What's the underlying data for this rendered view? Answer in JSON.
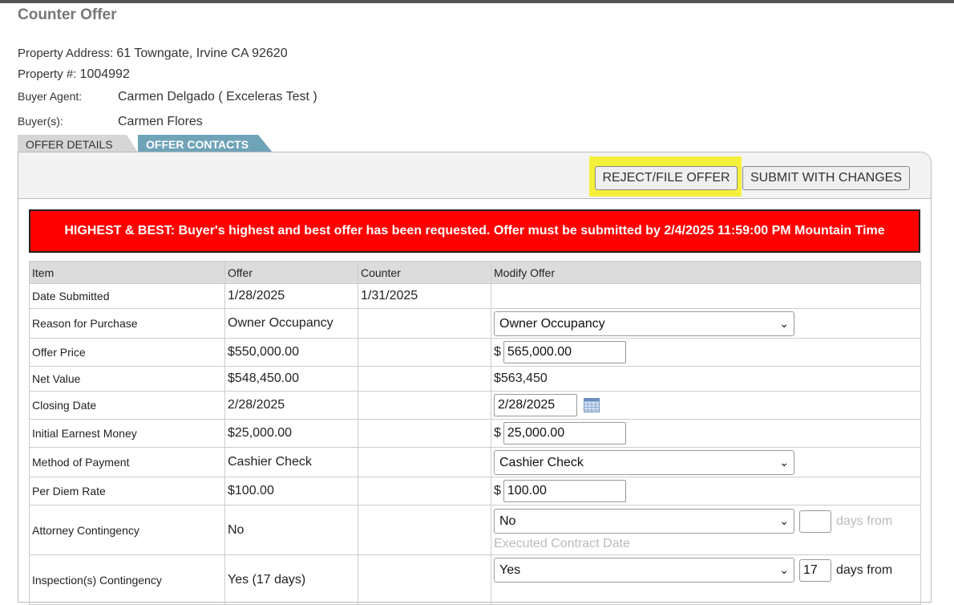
{
  "page": {
    "title": "Counter Offer"
  },
  "info": {
    "address_label": "Property Address:",
    "address_value": "61 Towngate, Irvine CA 92620",
    "property_label": "Property #:",
    "property_value": "1004992",
    "agent_label": "Buyer Agent:",
    "agent_value": "Carmen Delgado ( Exceleras Test )",
    "buyer_label": "Buyer(s):",
    "buyer_value": "Carmen Flores"
  },
  "tabs": {
    "details": "OFFER DETAILS",
    "contacts": "OFFER CONTACTS"
  },
  "toolbar": {
    "reject_label": "REJECT/FILE OFFER",
    "submit_label": "SUBMIT WITH CHANGES"
  },
  "banner": {
    "text": "HIGHEST & BEST: Buyer's highest and best offer has been requested. Offer must be submitted by 2/4/2025 11:59:00 PM Mountain Time"
  },
  "table": {
    "headers": {
      "item": "Item",
      "offer": "Offer",
      "counter": "Counter",
      "modify": "Modify Offer"
    },
    "rows": {
      "date_submitted": {
        "item": "Date Submitted",
        "offer": "1/28/2025",
        "counter": "1/31/2025"
      },
      "reason": {
        "item": "Reason for Purchase",
        "offer": "Owner Occupancy",
        "modify": "Owner Occupancy"
      },
      "price": {
        "item": "Offer Price",
        "offer": "$550,000.00",
        "currency": "$",
        "modify": "565,000.00"
      },
      "net": {
        "item": "Net Value",
        "offer": "$548,450.00",
        "modify": "$563,450"
      },
      "closing": {
        "item": "Closing Date",
        "offer": "2/28/2025",
        "modify": "2/28/2025"
      },
      "earnest": {
        "item": "Initial Earnest Money",
        "offer": "$25,000.00",
        "currency": "$",
        "modify": "25,000.00"
      },
      "payment": {
        "item": "Method of Payment",
        "offer": "Cashier Check",
        "modify": "Cashier Check"
      },
      "per_diem": {
        "item": "Per Diem Rate",
        "offer": "$100.00",
        "currency": "$",
        "modify": "100.00"
      },
      "attorney": {
        "item": "Attorney Contingency",
        "offer": "No",
        "modify": "No",
        "days": "",
        "days_from": "days from",
        "from_text": "Executed Contract Date"
      },
      "inspection": {
        "item": "Inspection(s) Contingency",
        "offer": "Yes (17 days)",
        "modify": "Yes",
        "days": "17",
        "days_from": "days from"
      }
    }
  },
  "icons": {
    "dropdown": "chevron-down-icon",
    "calendar": "calendar-icon"
  }
}
